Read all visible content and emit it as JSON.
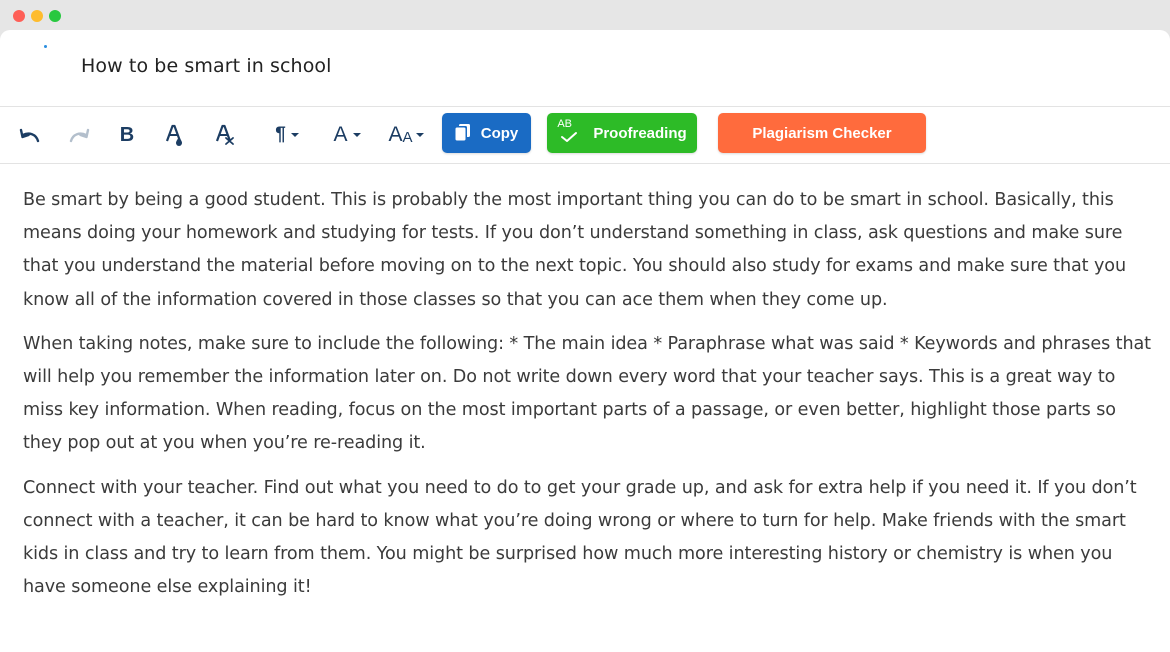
{
  "document": {
    "title": "How to be smart in school",
    "paragraphs": [
      "Be smart by being a good student. This is probably the most important thing you can do to be smart in school. Basically, this means doing your homework and studying for tests. If you don’t understand something in class, ask questions and make sure that you understand the material before moving on to the next topic. You should also study for exams and make sure that you know all of the information covered in those classes so that you can ace them when they come up.",
      "When taking notes, make sure to include the following: * The main idea * Paraphrase what was said * Keywords and phrases that will help you remember the information later on. Do not write down every word that your teacher says. This is a great way to miss key information. When reading, focus on the most important parts of a passage, or even better, highlight those parts so they pop out at you when you’re re-reading it.",
      "Connect with your teacher. Find out what you need to do to get your grade up, and ask for extra help if you need it. If you don’t connect with a teacher, it can be hard to know what you’re doing wrong or where to turn for help. Make friends with the smart kids in class and try to learn from them. You might be surprised how much more interesting history or chemistry is when you have someone else explaining it!"
    ]
  },
  "toolbar": {
    "undo_icon": "undo-icon",
    "redo_icon": "redo-icon",
    "bold_label": "B",
    "text_color_icon": "text-color-icon",
    "clear_format_icon": "clear-format-icon",
    "paragraph_label": "¶",
    "font_label": "A",
    "font_size_label_big": "A",
    "font_size_label_small": "A",
    "copy_label": "Copy",
    "proofreading_label": "Proofreading",
    "proofreading_icon_text": "AB",
    "plagiarism_label": "Plagiarism Checker"
  },
  "colors": {
    "copy": "#1a6bc4",
    "proofreading": "#2dbb27",
    "plagiarism": "#ff6b3d",
    "icon": "#1c3d63"
  }
}
